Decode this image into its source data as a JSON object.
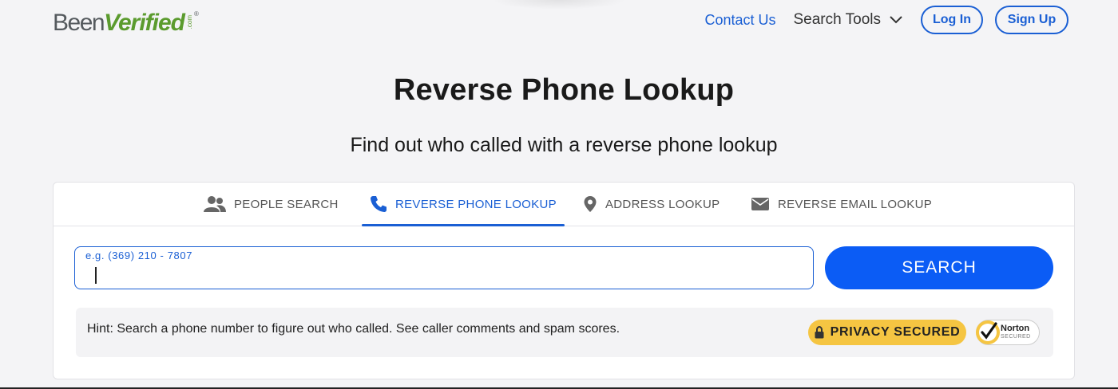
{
  "brand": {
    "been": "Been",
    "verified": "Verified",
    "dotcom": ".com",
    "reg": "®"
  },
  "nav": {
    "contact": "Contact Us",
    "search_tools": "Search Tools",
    "login": "Log In",
    "signup": "Sign Up"
  },
  "page": {
    "title": "Reverse Phone Lookup",
    "subtitle": "Find out who called with a reverse phone lookup"
  },
  "tabs": [
    {
      "label": "PEOPLE SEARCH",
      "icon": "people-icon",
      "active": false
    },
    {
      "label": "REVERSE PHONE LOOKUP",
      "icon": "phone-icon",
      "active": true
    },
    {
      "label": "ADDRESS LOOKUP",
      "icon": "map-pin-icon",
      "active": false
    },
    {
      "label": "REVERSE EMAIL LOOKUP",
      "icon": "envelope-icon",
      "active": false
    }
  ],
  "search": {
    "placeholder": "e.g. (369) 210 - 7807",
    "value": "",
    "button": "SEARCH"
  },
  "hint": {
    "text": "Hint: Search a phone number to figure out who called. See caller comments and spam scores.",
    "privacy_badge": "PRIVACY SECURED",
    "norton_name": "Norton",
    "norton_sub": "SECURED"
  },
  "colors": {
    "accent": "#1a5fd4",
    "button": "#0b5cf5",
    "brand_green": "#5b9b2e",
    "badge_yellow": "#f5c542",
    "background": "#f4f4f6"
  }
}
